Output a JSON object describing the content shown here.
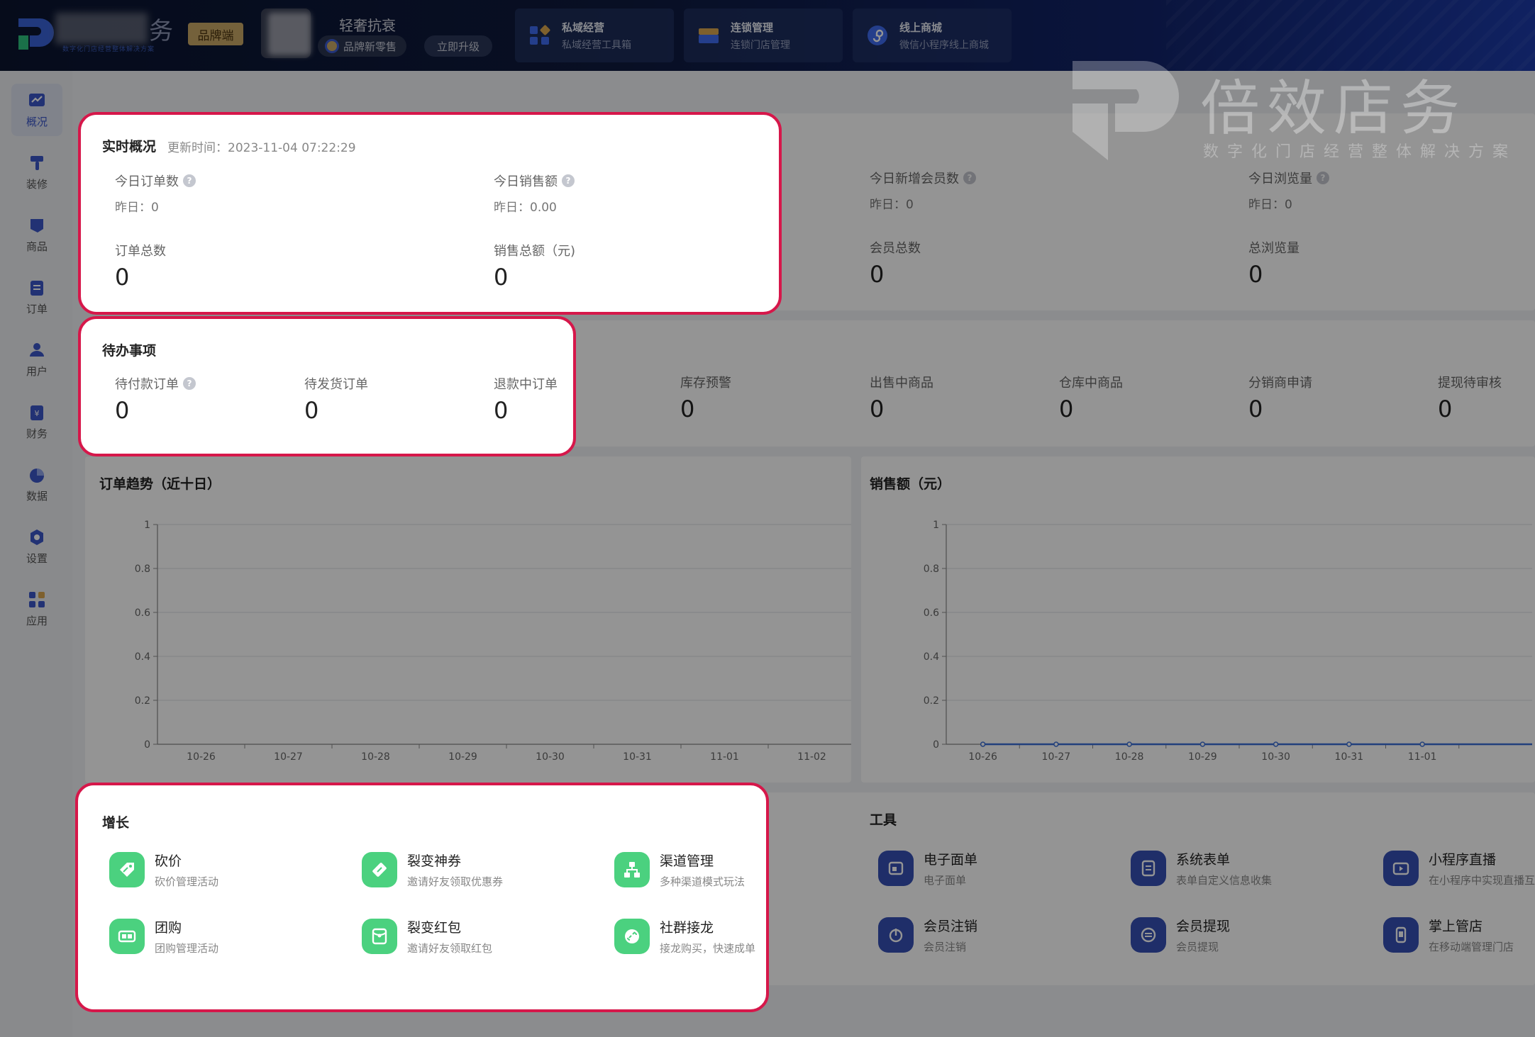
{
  "header": {
    "logo_char": "务",
    "logo_sub": "数字化门店经营整体解决方案",
    "brand_badge": "品牌端",
    "store_name": "轻奢抗衰",
    "store_plan": "品牌新零售",
    "upgrade_label": "立即升级",
    "nav": [
      {
        "title": "私域经营",
        "subtitle": "私域经营工具箱"
      },
      {
        "title": "连锁管理",
        "subtitle": "连锁门店管理"
      },
      {
        "title": "线上商城",
        "subtitle": "微信小程序线上商城"
      }
    ]
  },
  "sidebar": {
    "items": [
      {
        "label": "概况"
      },
      {
        "label": "装修"
      },
      {
        "label": "商品"
      },
      {
        "label": "订单"
      },
      {
        "label": "用户"
      },
      {
        "label": "财务"
      },
      {
        "label": "数据"
      },
      {
        "label": "设置"
      },
      {
        "label": "应用"
      }
    ]
  },
  "realtime": {
    "title": "实时概况",
    "update_label": "更新时间：2023-11-04 07:22:29",
    "today": [
      {
        "label": "今日订单数",
        "yesterday": "昨日：0"
      },
      {
        "label": "今日销售额",
        "yesterday": "昨日：0.00"
      },
      {
        "label": "今日新增会员数",
        "yesterday": "昨日：0"
      },
      {
        "label": "今日浏览量",
        "yesterday": "昨日：0"
      }
    ],
    "totals": [
      {
        "label": "订单总数",
        "value": "0"
      },
      {
        "label": "销售总额（元)",
        "value": "0"
      },
      {
        "label": "会员总数",
        "value": "0"
      },
      {
        "label": "总浏览量",
        "value": "0"
      }
    ]
  },
  "todo": {
    "title": "待办事项",
    "items": [
      {
        "label": "待付款订单",
        "value": "0"
      },
      {
        "label": "待发货订单",
        "value": "0"
      },
      {
        "label": "退款中订单",
        "value": "0"
      },
      {
        "label": "库存预警",
        "value": "0"
      },
      {
        "label": "出售中商品",
        "value": "0"
      },
      {
        "label": "仓库中商品",
        "value": "0"
      },
      {
        "label": "分销商申请",
        "value": "0"
      },
      {
        "label": "提现待审核",
        "value": "0"
      }
    ]
  },
  "chart_data": [
    {
      "type": "line",
      "title": "订单趋势（近十日）",
      "categories": [
        "10-26",
        "10-27",
        "10-28",
        "10-29",
        "10-30",
        "10-31",
        "11-01",
        "11-02"
      ],
      "series": [
        {
          "values": [
            0,
            0,
            0,
            0,
            0,
            0,
            0,
            0
          ]
        }
      ],
      "yticks": [
        "0",
        "0.2",
        "0.4",
        "0.6",
        "0.8",
        "1"
      ],
      "ylim": [
        0,
        1
      ]
    },
    {
      "type": "line",
      "title": "销售额（元）",
      "categories": [
        "10-26",
        "10-27",
        "10-28",
        "10-29",
        "10-30",
        "10-31",
        "11-01"
      ],
      "series": [
        {
          "values": [
            0,
            0,
            0,
            0,
            0,
            0,
            0
          ]
        }
      ],
      "yticks": [
        "0",
        "0.2",
        "0.4",
        "0.6",
        "0.8",
        "1"
      ],
      "ylim": [
        0,
        1
      ],
      "line_color": "#3b6fd6"
    }
  ],
  "growth": {
    "title": "增长",
    "items": [
      {
        "name": "砍价",
        "desc": "砍价管理活动",
        "icon": "bargain-icon"
      },
      {
        "name": "裂变神券",
        "desc": "邀请好友领取优惠券",
        "icon": "coupon-icon"
      },
      {
        "name": "渠道管理",
        "desc": "多种渠道模式玩法",
        "icon": "channel-icon"
      },
      {
        "name": "团购",
        "desc": "团购管理活动",
        "icon": "group-buy-icon"
      },
      {
        "name": "裂变红包",
        "desc": "邀请好友领取红包",
        "icon": "red-packet-icon"
      },
      {
        "name": "社群接龙",
        "desc": "接龙购买，快速成单",
        "icon": "community-icon"
      }
    ]
  },
  "tools": {
    "title": "工具",
    "items": [
      {
        "name": "电子面单",
        "desc": "电子面单",
        "icon": "waybill-icon"
      },
      {
        "name": "系统表单",
        "desc": "表单自定义信息收集",
        "icon": "form-icon"
      },
      {
        "name": "小程序直播",
        "desc": "在小程序中实现直播互",
        "icon": "live-icon"
      },
      {
        "name": "会员注销",
        "desc": "会员注销",
        "icon": "power-icon"
      },
      {
        "name": "会员提现",
        "desc": "会员提现",
        "icon": "withdraw-icon"
      },
      {
        "name": "掌上管店",
        "desc": "在移动端管理门店",
        "icon": "mobile-icon"
      }
    ]
  },
  "watermark": {
    "text": "倍效店务",
    "sub": "数字化门店经营整体解决方案"
  },
  "colors": {
    "accent": "#3b56c9",
    "highlight_border": "#d6174a",
    "growth_icon": "#4bd17f",
    "tool_icon": "#3650b5"
  }
}
